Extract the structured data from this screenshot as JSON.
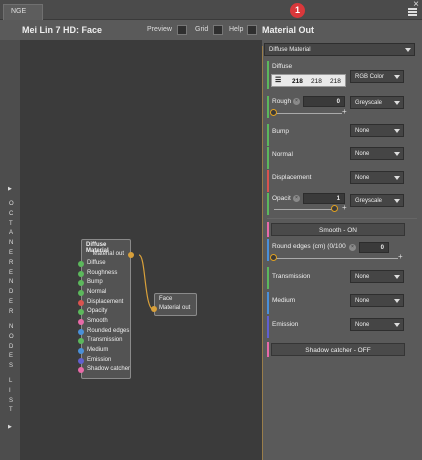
{
  "window": {
    "tab": "NGE",
    "notification_count": "1",
    "close_symbol": "×"
  },
  "header": {
    "title": "Mei Lin 7 HD: Face",
    "preview_label": "Preview",
    "grid_label": "Grid",
    "help_label": "Help",
    "mode_label": "Material Out"
  },
  "side_strip": {
    "letters_top": [
      "O",
      "C",
      "T",
      "A",
      "N",
      "E",
      "R",
      "E",
      "N",
      "D",
      "E",
      "R"
    ],
    "letters_mid": [
      "N",
      "O",
      "D",
      "E",
      "S"
    ],
    "letters_bottom": [
      "L",
      "I",
      "S",
      "T"
    ],
    "arrow": "▶"
  },
  "nodes": {
    "diffuse_material": {
      "title": "Diffuse Material",
      "output": "Material out",
      "inputs": [
        {
          "label": "Diffuse",
          "color": "#5cb85c"
        },
        {
          "label": "Roughness",
          "color": "#5cb85c"
        },
        {
          "label": "Bump",
          "color": "#5cb85c"
        },
        {
          "label": "Normal",
          "color": "#5cb85c"
        },
        {
          "label": "Displacement",
          "color": "#d9534f"
        },
        {
          "label": "Opacity",
          "color": "#5cb85c"
        },
        {
          "label": "Smooth",
          "color": "#e86aa8"
        },
        {
          "label": "Rounded edges",
          "color": "#4a90d9"
        },
        {
          "label": "Transmission",
          "color": "#5cb85c"
        },
        {
          "label": "Medium",
          "color": "#4a90d9"
        },
        {
          "label": "Emission",
          "color": "#6060d0"
        },
        {
          "label": "Shadow catcher",
          "color": "#e86aa8"
        }
      ]
    },
    "face": {
      "title": "Face",
      "output": "Material out"
    }
  },
  "panel": {
    "material_type": "Diffuse Material",
    "diffuse": {
      "label": "Diffuse",
      "r": "218",
      "g": "218",
      "b": "218",
      "mode": "RGB Color"
    },
    "roughness": {
      "label": "Rough",
      "value": "0",
      "mode": "Greyscale"
    },
    "bump": {
      "label": "Bump",
      "value": "None"
    },
    "normal": {
      "label": "Normal",
      "value": "None"
    },
    "displacement": {
      "label": "Displacement",
      "value": "None"
    },
    "opacity": {
      "label": "Opacit",
      "value": "1",
      "mode": "Greyscale"
    },
    "smooth_button": "Smooth - ON",
    "rounded_edges": {
      "label": "Round edges (cm) (0/100",
      "value": "0"
    },
    "transmission": {
      "label": "Transmission",
      "value": "None"
    },
    "medium": {
      "label": "Medium",
      "value": "None"
    },
    "emission": {
      "label": "Emission",
      "value": "None"
    },
    "shadow_catcher_button": "Shadow catcher - OFF",
    "plus": "+",
    "x": "×"
  },
  "colors": {
    "accent": "#d8a03a",
    "green": "#5cb85c",
    "red": "#d9534f",
    "pink": "#e86aa8",
    "blue": "#4a90d9",
    "purple": "#6060d0"
  }
}
